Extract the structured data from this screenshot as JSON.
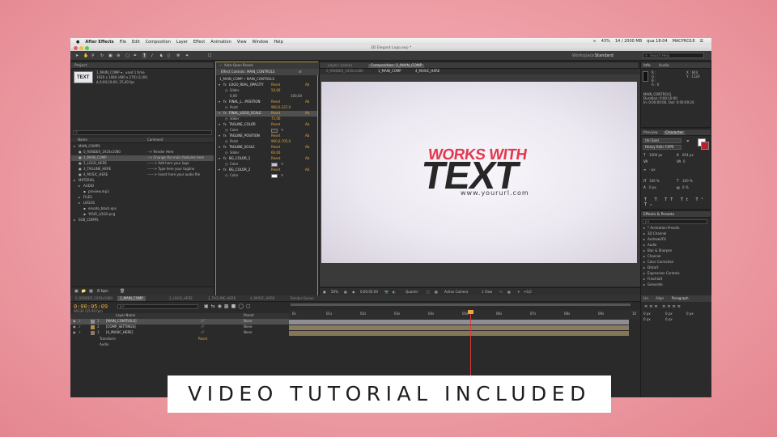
{
  "menubar": {
    "app": "After Effects",
    "items": [
      "File",
      "Edit",
      "Composition",
      "Layer",
      "Effect",
      "Animation",
      "View",
      "Window",
      "Help"
    ],
    "battery": "43%",
    "mem": "14 / 2000 MB",
    "clock": "qua 18:04",
    "user": "MACPRO18"
  },
  "window_title": "3D Elegant Logo.aep *",
  "workspace": {
    "label": "Workspace:",
    "value": "Standard",
    "search_placeholder": "Search Help"
  },
  "project": {
    "tab": "Project",
    "comp_name": "1_MAIN_COMP ▾ , used 1 time",
    "comp_info1": "1920 x 1080  (480 x 270) (1,00)",
    "comp_info2": "Δ 0;00;10;00, 25,00 fps",
    "thumb": "TEXT",
    "col_name": "Name",
    "col_comment": "Comment",
    "items": [
      {
        "name": "MAIN_COMPS",
        "comment": ""
      },
      {
        "name": "0_RENDER_1920x1080",
        "comment": "--> Render Here"
      },
      {
        "name": "1_MAIN_COMP",
        "comment": "--> Change the main features here"
      },
      {
        "name": "2_LOGO_HERE",
        "comment": "------> Add here your logo"
      },
      {
        "name": "3_TAGLINE_HERE",
        "comment": "------> Type here your tagline"
      },
      {
        "name": "4_MUSIC_HERE",
        "comment": "------> Insert here your audio file"
      },
      {
        "name": "MATERIAL",
        "comment": ""
      },
      {
        "name": "AUDIO",
        "comment": ""
      },
      {
        "name": "preview.mp3",
        "comment": ""
      },
      {
        "name": "FILES",
        "comment": ""
      },
      {
        "name": "LOGOS",
        "comment": ""
      },
      {
        "name": "envato_black.eps",
        "comment": ""
      },
      {
        "name": "YOUR_LOGO.png",
        "comment": ""
      },
      {
        "name": "SUB_COMPS",
        "comment": ""
      }
    ],
    "bpc": "8 bpc"
  },
  "effect_controls": {
    "auto_open": "Auto-Open Panels",
    "tab": "Effect Controls: MAIN_CONTROLS",
    "breadcrumb": "1_MAIN_COMP • MAIN_CONTROLS",
    "reset": "Reset",
    "ab": "Ab",
    "rows": [
      {
        "kind": "fx",
        "label": "LOGO_REAL_OPACITY"
      },
      {
        "kind": "prop",
        "label": "Slider",
        "value": "50,00"
      },
      {
        "kind": "range",
        "min": "0,00",
        "max": "100,00"
      },
      {
        "kind": "fx",
        "label": "FINAL_L...POSITION"
      },
      {
        "kind": "prop",
        "label": "Point",
        "value": "960,0,337,0"
      },
      {
        "kind": "fx",
        "label": "FINAL_LOGO_SCALE"
      },
      {
        "kind": "prop",
        "label": "Slider",
        "value": "75,00"
      },
      {
        "kind": "fx",
        "label": "TAGLINE_COLOR"
      },
      {
        "kind": "prop",
        "label": "Color",
        "value": ""
      },
      {
        "kind": "fx",
        "label": "TAGLINE_POSITION"
      },
      {
        "kind": "prop",
        "label": "Point",
        "value": "960,0,705,0"
      },
      {
        "kind": "fx",
        "label": "TAGLINE_SCALE"
      },
      {
        "kind": "prop",
        "label": "Slider",
        "value": "60,00"
      },
      {
        "kind": "fx",
        "label": "BG_COLOR_1"
      },
      {
        "kind": "prop",
        "label": "Color",
        "value": ""
      },
      {
        "kind": "fx",
        "label": "BG_COLOR_2"
      },
      {
        "kind": "prop",
        "label": "Color",
        "value": ""
      }
    ]
  },
  "composition": {
    "layer_tab": "Layer: (none)",
    "tab": "Composition: 1_MAIN_COMP",
    "crumbs": [
      "0_RENDER_1920x1080",
      "1_MAIN_COMP",
      "4_MUSIC_HERE"
    ],
    "works": "WORKS WITH",
    "text": "TEXT",
    "url": "www.yoururl.com",
    "zoom": "50%",
    "time": "0:00:05:09",
    "quality": "Quarter",
    "camera": "Active Camera",
    "view": "1 View",
    "exposure": "+0,0"
  },
  "info": {
    "tabs": [
      "Info",
      "Audio"
    ],
    "r": "R :",
    "g": "G :",
    "b": "B :",
    "a": "A : 0",
    "x": "X : 644",
    "y": "Y : 1120",
    "name": "MAIN_CONTROLS",
    "duration": "Duration: 0:00:10:00",
    "inout": "In: 0:00:00:00, Out: 0:00:09:24"
  },
  "character": {
    "tabs": [
      "Preview",
      "Character"
    ],
    "font": "Uni Sans",
    "style": "Heavy Italic CAPS",
    "size": "1000 px",
    "leading": "654 px",
    "tracking": "0",
    "stroke": "- px",
    "vscale": "100 %",
    "hscale": "100 %",
    "baseline": "0 px",
    "tsume": "0 %"
  },
  "effects_presets": {
    "tab": "Effects & Presets",
    "search_placeholder": "ρ+",
    "items": [
      "* Animation Presets",
      "3D Channel",
      "AndrewVFX",
      "Audio",
      "Blur & Sharpen",
      "Channel",
      "Color Correction",
      "Distort",
      "Expression Controls",
      "Frischluft",
      "Generate"
    ]
  },
  "paragraph": {
    "tabs": [
      "Lin",
      "Align",
      "Paragraph"
    ],
    "v1": "0 px",
    "v2": "0 px",
    "v3": "0 px",
    "v4": "0 px",
    "v5": "0 px"
  },
  "timeline": {
    "tabs": [
      "0_RENDER_1920x1080",
      "1_MAIN_COMP",
      "2_LOGO_HERE",
      "3_TAGLINE_HERE",
      "4_MUSIC_HERE",
      "Render Queue"
    ],
    "timecode": "0:00:05:09",
    "frames": "00134 (25.00 fps)",
    "search_placeholder": "ρ+",
    "col_source": "Layer Name",
    "col_parent": "Parent",
    "layers": [
      {
        "num": "1",
        "name": "[MAIN_CONTROLS]",
        "parent": "None"
      },
      {
        "num": "2",
        "name": "[COMP_SETTINGS]",
        "parent": "None"
      },
      {
        "num": "3",
        "name": "[4_MUSIC_HERE]",
        "parent": "None"
      }
    ],
    "transform": "Transform",
    "transform_reset": "Reset",
    "audio": "Audio",
    "ruler": [
      "0s",
      "01s",
      "02s",
      "03s",
      "04s",
      "05s",
      "06s",
      "07s",
      "08s",
      "09s",
      "10"
    ]
  },
  "banner": "VIDEO TUTORIAL INCLUDED"
}
